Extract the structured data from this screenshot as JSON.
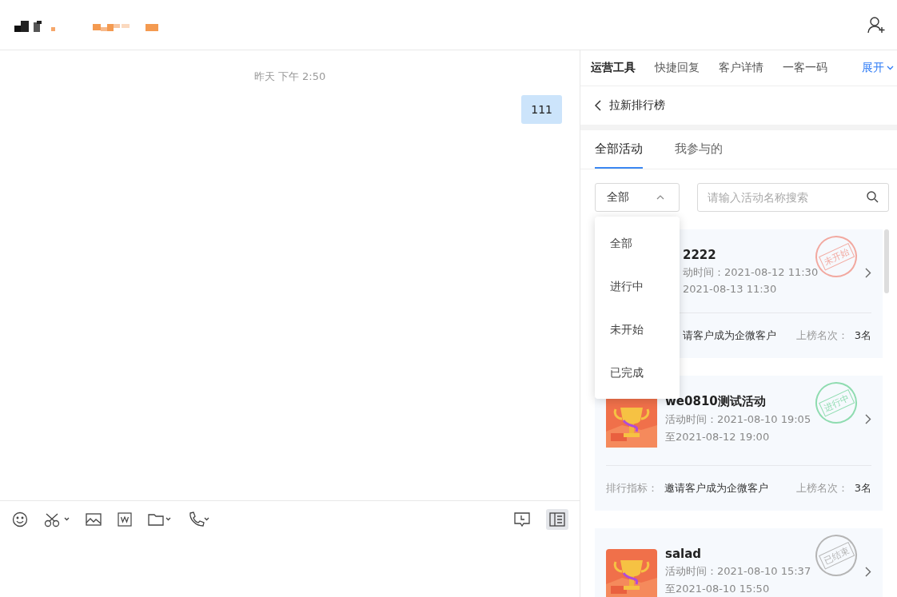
{
  "chat": {
    "timestamp": "昨天 下午 2:50",
    "messages": [
      {
        "text": "111",
        "outgoing": true
      }
    ]
  },
  "composer": {
    "panel_toggle_on": true
  },
  "side_panel": {
    "tabs": [
      {
        "label": "运营工具",
        "selected": true
      },
      {
        "label": "快捷回复",
        "selected": false
      },
      {
        "label": "客户详情",
        "selected": false
      },
      {
        "label": "一客一码",
        "selected": false
      }
    ],
    "expand_link": "展开",
    "page_title": "拉新排行榜",
    "sub_tabs": [
      {
        "label": "全部活动",
        "selected": true
      },
      {
        "label": "我参与的",
        "selected": false
      }
    ],
    "filter": {
      "value": "全部",
      "expanded": true,
      "options": [
        "全部",
        "进行中",
        "未开始",
        "已完成"
      ]
    },
    "search": {
      "placeholder": "请输入活动名称搜索"
    },
    "cards": [
      {
        "covered": true,
        "title": "2222",
        "time_label": "动时间：",
        "time_start": "2021-08-12 11:30",
        "time_end": "2021-08-13 11:30",
        "metric": "请客户成为企微客户",
        "rank_label": "上榜名次：",
        "rank": "3名",
        "status": "未开始",
        "color": "#f2a9a0"
      },
      {
        "covered": false,
        "title": "we0810测试活动",
        "time_label": "活动时间：",
        "time_start": "2021-08-10 19:05",
        "end_prefix": "至",
        "time_end": "2021-08-12 19:00",
        "metric_label": "排行指标：",
        "metric": "邀请客户成为企微客户",
        "rank_label": "上榜名次：",
        "rank": "3名",
        "status": "进行中",
        "color": "#8fdcb0"
      },
      {
        "covered": false,
        "title": "salad",
        "time_label": "活动时间：",
        "time_start": "2021-08-10 15:37",
        "end_prefix": "至",
        "time_end": "2021-08-10 15:50",
        "status": "已结束",
        "color": "#b5b5b5"
      }
    ]
  }
}
